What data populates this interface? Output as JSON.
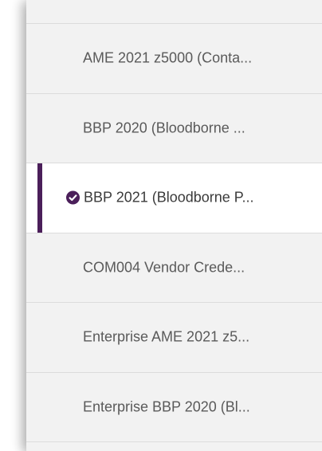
{
  "list": {
    "items": [
      {
        "label": "AME 2021 z5000 (Conta..."
      },
      {
        "label": "BBP 2020 (Bloodborne ..."
      },
      {
        "label": "BBP 2021 (Bloodborne P...",
        "selected": true,
        "icon": "check-circle-icon"
      },
      {
        "label": "COM004 Vendor Crede..."
      },
      {
        "label": "Enterprise AME 2021 z5..."
      },
      {
        "label": "Enterprise BBP 2020 (Bl..."
      }
    ]
  },
  "colors": {
    "accent": "#4b1f5a",
    "panel_bg": "#f2f2f2",
    "selected_bg": "#ffffff",
    "text": "#5a5a5a",
    "divider": "#dcdcdc"
  }
}
